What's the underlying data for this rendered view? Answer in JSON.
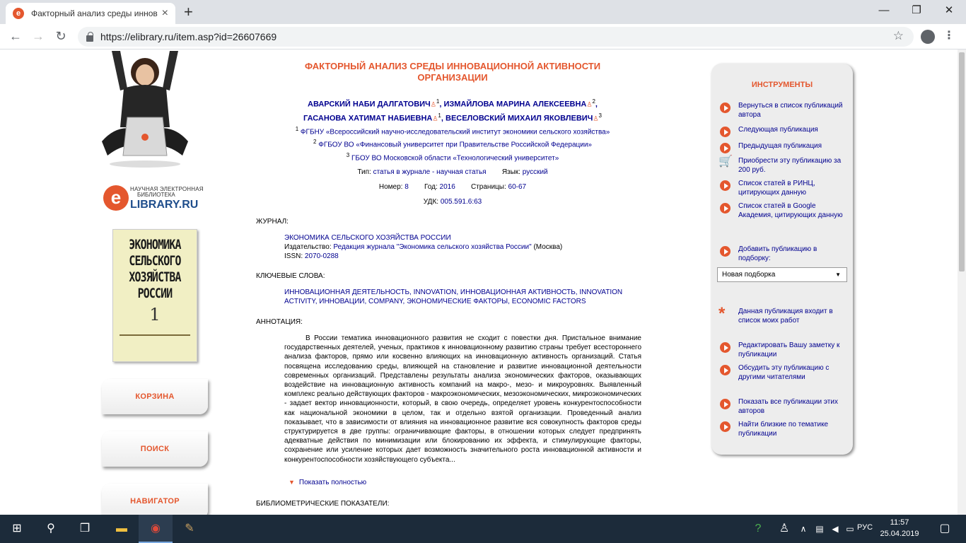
{
  "browser": {
    "tab_title": "Факторный анализ среды инноваци",
    "url": "https://elibrary.ru/item.asp?id=26607669"
  },
  "left": {
    "logo_line1": "НАУЧНАЯ ЭЛЕКТРОННАЯ",
    "logo_line2": "БИБЛИОТЕКА",
    "logo_main": "LIBRARY.RU",
    "cover_title": "ЭКОНОМИКА СЕЛЬСКОГО ХОЗЯЙСТВА РОССИИ",
    "cover_number": "1",
    "buttons": [
      "КОРЗИНА",
      "ПОИСК",
      "НАВИГАТОР"
    ]
  },
  "article": {
    "title": "ФАКТОРНЫЙ АНАЛИЗ СРЕДЫ ИННОВАЦИОННОЙ АКТИВНОСТИ ОРГАНИЗАЦИИ",
    "authors": [
      {
        "name": "АВАРСКИЙ НАБИ ДАЛГАТОВИЧ",
        "aff": "1"
      },
      {
        "name": "ИЗМАЙЛОВА МАРИНА АЛЕКСЕЕВНА",
        "aff": "2"
      },
      {
        "name": "ГАСАНОВА ХАТИМАТ НАБИЕВНА",
        "aff": "1"
      },
      {
        "name": "ВЕСЕЛОВСКИЙ МИХАИЛ ЯКОВЛЕВИЧ",
        "aff": "3"
      }
    ],
    "affiliations": [
      {
        "n": "1",
        "text": "ФГБНУ «Всероссийский научно-исследовательский институт экономики сельского хозяйства»"
      },
      {
        "n": "2",
        "text": "ФГБОУ ВО «Финансовый университет при Правительстве Российской Федерации»"
      },
      {
        "n": "3",
        "text": "ГБОУ ВО Московской области «Технологический университет»"
      }
    ],
    "type_label": "Тип:",
    "type_value": "статья в журнале - научная статья",
    "lang_label": "Язык:",
    "lang_value": "русский",
    "number_label": "Номер:",
    "number_value": "8",
    "year_label": "Год:",
    "year_value": "2016",
    "pages_label": "Страницы:",
    "pages_value": "60-67",
    "udk_label": "УДК:",
    "udk_value": "005.591.6:63",
    "journal_heading": "ЖУРНАЛ:",
    "journal_name": "ЭКОНОМИКА СЕЛЬСКОГО ХОЗЯЙСТВА РОССИИ",
    "publisher_label": "Издательство:",
    "publisher_value": "Редакция журнала \"Экономика сельского хозяйства России\"",
    "publisher_city": "(Москва)",
    "issn_label": "ISSN:",
    "issn_value": "2070-0288",
    "keywords_heading": "КЛЮЧЕВЫЕ СЛОВА:",
    "keywords": "ИННОВАЦИОННАЯ ДЕЯТЕЛЬНОСТЬ, INNOVATION, ИННОВАЦИОННАЯ АКТИВНОСТЬ, INNOVATION ACTIVITY, ИННОВАЦИИ, COMPANY, ЭКОНОМИЧЕСКИЕ ФАКТОРЫ, ECONOMIC FACTORS",
    "abstract_heading": "АННОТАЦИЯ:",
    "abstract": "В России тематика инновационного развития не сходит с повестки дня. Пристальное внимание государственных деятелей, ученых, практиков к инновационному развитию страны требует всестороннего анализа факторов, прямо или косвенно влияющих на инновационную активность организаций. Статья посвящена исследованию среды, влияющей на становление и развитие инновационной деятельности современных организаций. Представлены результаты анализа экономических факторов, оказывающих воздействие на инновационную активность компаний на макро-, мезо- и микроуровнях. Выявленный комплекс реально действующих факторов - макроэкономических, мезоэкономических, микроэкономических - задает вектор инновационности, который, в свою очередь, определяет уровень конкурентоспособности как национальной экономики в целом, так и отдельно взятой организации. Проведенный анализ показывает, что в зависимости от влияния на инновационное развитие вся совокупность факторов среды структурируется в две группы: ограничивающие факторы, в отношении которых следует предпринять адекватные действия по минимизации или блокированию их эффекта, и стимулирующие факторы, сохранение или усиление которых дает возможность значительного роста инновационной активности и конкурентоспособности хозяйствующего субъекта...",
    "show_full": "Показать полностью",
    "biblio_heading": "БИБЛИОМЕТРИЧЕСКИЕ ПОКАЗАТЕЛИ:"
  },
  "tools": {
    "heading": "ИНСТРУМЕНТЫ",
    "items": [
      "Вернуться в список публикаций автора",
      "Следующая публикация",
      "Предыдущая публикация",
      "Приобрести эту публикацию за 200 руб.",
      "Список статей в РИНЦ, цитирующих данную",
      "Список статей в Google Академия, цитирующих данную",
      "Добавить публикацию в подборку:",
      "Данная публикация входит в список моих работ",
      "Редактировать Вашу заметку к публикации",
      "Обсудить эту публикацию с другими читателями",
      "Показать все публикации этих авторов",
      "Найти близкие по тематике публикации"
    ],
    "select_value": "Новая подборка"
  },
  "taskbar": {
    "lang": "РУС",
    "time": "11:57",
    "date": "25.04.2019"
  },
  "colors": {
    "accent": "#e4572e",
    "link": "#00008f",
    "taskbar": "#1c2b3a"
  }
}
